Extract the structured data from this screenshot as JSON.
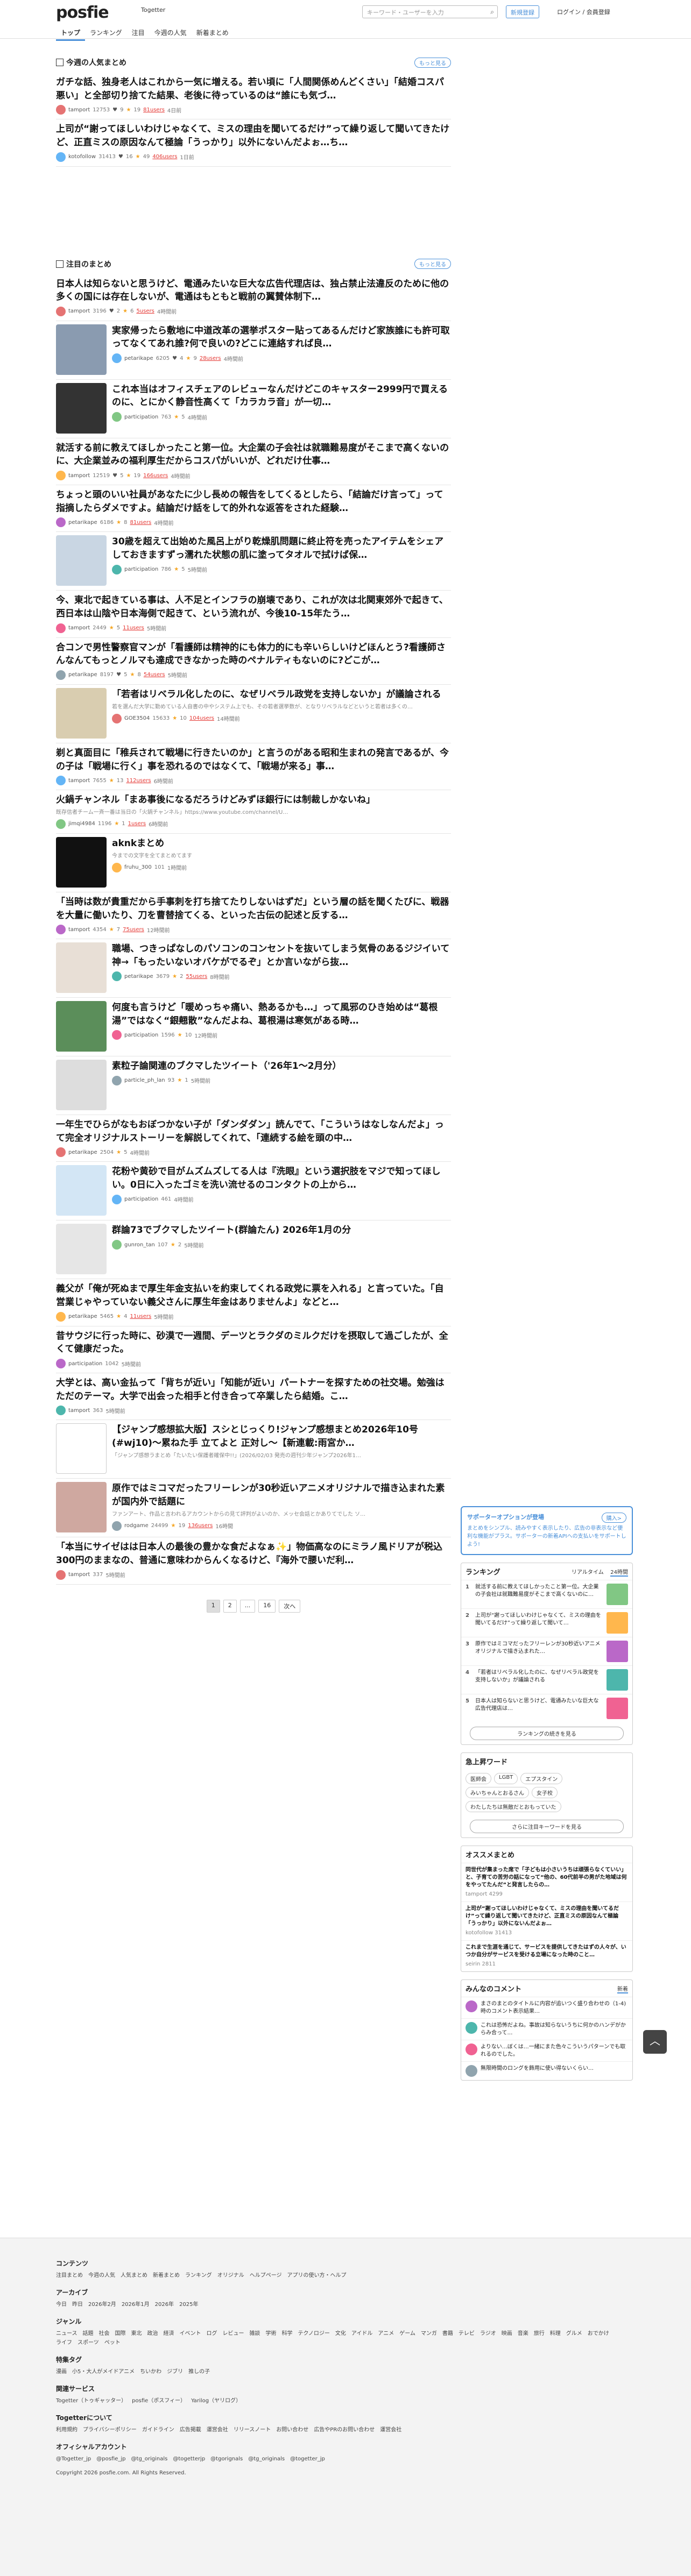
{
  "header": {
    "logo": "posfie",
    "logo_sub": "Togetter",
    "search_placeholder": "キーワード・ユーザーを入力",
    "register": "新規登録",
    "login": "ログイン / 会員登録",
    "nav": [
      "トップ",
      "ランキング",
      "注目",
      "今週の人気",
      "新着まとめ"
    ]
  },
  "popular": {
    "title": "今週の人気まとめ",
    "more": "もっと見る",
    "items": [
      {
        "title": "ガチな話、独身老人はこれから一気に増える。若い頃に「人間関係めんどくさい」「結婚コスパ悪い」と全部切り捨てた結果、老後に待っているのは“誰にも気づ…",
        "user": "tamport",
        "views": "12753",
        "fav": "9",
        "stars": "19",
        "bk": "81users",
        "date": "4日前"
      },
      {
        "title": "上司が“謝ってほしいわけじゃなくて、ミスの理由を聞いてるだけ”って繰り返して聞いてきたけど、正直ミスの原因なんて極論「うっかり」以外にないんだよぉ…ち…",
        "user": "kotofollow",
        "views": "31413",
        "fav": "16",
        "stars": "49",
        "bk": "406users",
        "date": "1日前"
      }
    ]
  },
  "featured": {
    "title": "注目のまとめ",
    "more": "もっと見る",
    "items": [
      {
        "title": "日本人は知らないと思うけど、電通みたいな巨大な広告代理店は、独占禁止法違反のために他の多くの国には存在しないが、電通はもともと戦前の翼賛体制下…",
        "user": "tamport",
        "views": "3196",
        "fav": "2",
        "stars": "6",
        "bk": "5users",
        "date": "4時間前",
        "thumb": ""
      },
      {
        "title": "実家帰ったら敷地に中道改革の選挙ポスター貼ってあるんだけど家族誰にも許可取ってなくてあれ誰?何で良いの?どこに連絡すれば良…",
        "user": "petarikape",
        "views": "6205",
        "fav": "4",
        "stars": "9",
        "bk": "28users",
        "date": "4時間前",
        "thumb": "#8a9bb0"
      },
      {
        "title": "これ本当はオフィスチェアのレビューなんだけどこのキャスター2999円で買えるのに、とにかく静音性高くて「カラカラ音」が一切…",
        "user": "participation",
        "views": "763",
        "fav": "",
        "stars": "5",
        "bk": "",
        "date": "4時間前",
        "thumb": "#333333"
      },
      {
        "title": "就活する前に教えてほしかったこと第一位。大企業の子会社は就職難易度がそこまで高くないのに、大企業並みの福利厚生だからコスパがいいが、どれだけ仕事…",
        "user": "tamport",
        "views": "12519",
        "fav": "5",
        "stars": "19",
        "bk": "166users",
        "date": "4時間前",
        "thumb": ""
      },
      {
        "title": "ちょっと頭のいい社員があなたに少し長めの報告をしてくるとしたら、「結論だけ言って」って指摘したらダメですよ。結論だけ話をして的外れな返答をされた経験…",
        "user": "petarikape",
        "views": "6186",
        "fav": "",
        "stars": "8",
        "bk": "81users",
        "date": "4時間前",
        "thumb": ""
      },
      {
        "title": "30歳を超えて出始めた風呂上がり乾燥肌問題に終止符を売ったアイテムをシェアしておきますずっ濡れた状態の肌に塗ってタオルで拭けば保…",
        "user": "participation",
        "views": "786",
        "fav": "",
        "stars": "5",
        "bk": "",
        "date": "5時間前",
        "thumb": "#c9d6e3"
      },
      {
        "title": "今、東北で起きている事は、人不足とインフラの崩壊であり、これが次は北関東郊外で起きて、西日本は山陰や日本海側で起きて、という流れが、今後10-15年たう…",
        "user": "tamport",
        "views": "2449",
        "fav": "",
        "stars": "5",
        "bk": "11users",
        "date": "5時間前",
        "thumb": ""
      },
      {
        "title": "合コンで男性警察官マンが「看護師は精神的にも体力的にも辛いらしいけどほんとう?看護師さんなんてもっとノルマも達成できなかった時のペナルティもないのに?どこが…",
        "user": "petarikape",
        "views": "8197",
        "fav": "5",
        "stars": "8",
        "bk": "54users",
        "date": "5時間前",
        "thumb": ""
      },
      {
        "title": "「若者はリベラル化したのに、なぜリベラル政党を支持しないか」が議論される",
        "desc": "若を選んだ大学に勤めている人自書の中やシステム上でも、その若者選挙数が、となりリベラルなどというと若者は多くの…",
        "user": "GOE3504",
        "views": "15633",
        "fav": "",
        "stars": "10",
        "bk": "104users",
        "date": "14時間前",
        "thumb": "#d9cdb0"
      },
      {
        "title": "剃と真面目に「稚兵されて戦場に行きたいのか」と言うのがある昭和生まれの発言であるが、今の子は「戦場に行く」事を恐れるのではなくて、「戦場が来る」事…",
        "user": "tamport",
        "views": "7655",
        "fav": "",
        "stars": "13",
        "bk": "112users",
        "date": "6時間前",
        "thumb": ""
      },
      {
        "title": "火鍋チャンネル「まあ事後になるだろうけどみずほ銀行には制裁しかないね」",
        "desc": "既存信者チーム一斉一番は当日の「火鍋チャンネル」https://www.youtube.com/channel/U…",
        "user": "jimqi4984",
        "views": "1196",
        "fav": "",
        "stars": "1",
        "bk": "1users",
        "date": "6時間前",
        "thumb": ""
      },
      {
        "title": "aknkまとめ",
        "desc": "今までの文字を全てまとめてます",
        "user": "fruhu_300",
        "views": "101",
        "fav": "",
        "stars": "",
        "bk": "",
        "date": "1時間前",
        "thumb": "#111111"
      },
      {
        "title": "「当時は数が貴重だから手事刺を打ち捨てたりしないはずだ」という層の話を聞くたびに、戦器を大量に働いたり、刀を曹替捨てくる、といった古伝の記述と反する…",
        "user": "tamport",
        "views": "4354",
        "fav": "",
        "stars": "7",
        "bk": "75users",
        "date": "12時間前",
        "thumb": ""
      },
      {
        "title": "職場、つきっぱなしのパソコンのコンセントを抜いてしまう気骨のあるジジイいて神→「もったいないオバケがでるぞ」とか言いながら抜…",
        "user": "petarikape",
        "views": "3679",
        "fav": "",
        "stars": "2",
        "bk": "55users",
        "date": "8時間前",
        "thumb": "#e8dfd6"
      },
      {
        "title": "何度も言うけど「暖めっちゃ痛い、熱あるかも…」って風邪のひき始めは“葛根湯”ではなく“銀翹散”なんだよね、葛根湯は寒気がある時…",
        "user": "participation",
        "views": "1596",
        "fav": "",
        "stars": "10",
        "bk": "",
        "date": "12時間前",
        "thumb": "#5b8e5a"
      },
      {
        "title": "素粒子論関連のブクマしたツイート（'26年1〜2月分）",
        "user": "particle_ph_lan",
        "views": "93",
        "fav": "",
        "stars": "1",
        "bk": "",
        "date": "5時間前",
        "thumb": "#dddddd"
      },
      {
        "title": "一年生でひらがなもおぼつかない子が「ダンダダン」読んでて、「こういうはなしなんだよ」って完全オリジナルストーリーを解説してくれて、「連続する絵を頭の中…",
        "user": "petarikape",
        "views": "2504",
        "fav": "",
        "stars": "5",
        "bk": "",
        "date": "4時間前",
        "thumb": ""
      },
      {
        "title": "花粉や黄砂で目がムズムズしてる人は『洗眼』という選択肢をマジで知ってほしい。0日に入ったゴミを洗い流せるのコンタクトの上から…",
        "user": "participation",
        "views": "461",
        "fav": "",
        "stars": "",
        "bk": "",
        "date": "4時間前",
        "thumb": "#d3e6f5"
      },
      {
        "title": "群論73でブクマしたツイート(群論たん) 2026年1月の分",
        "user": "gunron_tan",
        "views": "107",
        "fav": "",
        "stars": "2",
        "bk": "",
        "date": "5時間前",
        "thumb": "#e6e6e6"
      },
      {
        "title": "義父が「俺が死ぬまで厚生年金支払いを約束してくれる政党に票を入れる」と言っていた。「自営業じゃやっていない義父さんに厚生年金はありませんよ」などと…",
        "user": "petarikape",
        "views": "5465",
        "fav": "",
        "stars": "4",
        "bk": "11users",
        "date": "5時間前",
        "thumb": ""
      },
      {
        "title": "昔サウジに行った時に、砂漠で一週間、デーツとラクダのミルクだけを摂取して過ごしたが、全くて健康だった。",
        "user": "participation",
        "views": "1042",
        "fav": "",
        "stars": "",
        "bk": "",
        "date": "5時間前",
        "thumb": ""
      },
      {
        "title": "大学とは、高い金払って「背ちが近い」「知能が近い」パートナーを探すための社交場。勉強はただのテーマ。大学で出会った相手と付き合って卒業したら結婚。こ…",
        "user": "tamport",
        "views": "363",
        "fav": "",
        "stars": "",
        "bk": "",
        "date": "5時間前",
        "thumb": ""
      },
      {
        "title": "【ジャンプ感想拡大版】スシとじっくり!ジャンプ感想まとめ2026年10号(#wj10)〜累ねた手 立てよと 正対し〜【新連載:雨宮か…",
        "desc": "「ジャンプ感想ラまとめ「たいたい保護者確保中!!」(2026/02/03 発売の週刊少年ジャンプ2026年1…",
        "user": "",
        "views": "",
        "fav": "",
        "stars": "",
        "bk": "",
        "date": "",
        "thumb": "#ffffff"
      },
      {
        "title": "原作ではミコマだったフリーレンが30秒近いアニメオリジナルで描き込まれた素が国内外で話題に",
        "desc": "ファンアート、作品と言われるアカウントからの見て評判がよいのか、メッセ会話とかありてでした ソ…",
        "user": "rodgame",
        "views": "24499",
        "fav": "",
        "stars": "19",
        "bk": "136users",
        "date": "16時間",
        "thumb": "#cfa8a0"
      },
      {
        "title": "「本当にサイゼはは日本人の最後の豊かな食だよなぁ✨」物価高なのにミラノ風ドリアが税込300円のままなの、普通に意味わからんくなるけど、『海外で腰いだ利…",
        "user": "tamport",
        "views": "337",
        "fav": "",
        "stars": "",
        "bk": "",
        "date": "5時間前",
        "thumb": ""
      }
    ]
  },
  "pager": [
    "1",
    "2",
    "...",
    "16",
    "次へ"
  ],
  "sidebar": {
    "support_title": "サポーターオプションが登場",
    "support_btn": "購入>",
    "support_text": "まとめをシンプル、読みやすく表示したり、広告の非表示など便利な機能がプラス。サポーターの新着APIへの支払いをサポートしよう!",
    "ranking_title": "ランキング",
    "ranking_tabs": [
      "リアルタイム",
      "24時間"
    ],
    "ranking": [
      "就活する前に教えてほしかったこと第一位。大企業の子会社は就職難易度がそこまで高くないのに…",
      "上司が“謝ってほしいわけじゃなくて、ミスの理由を聞いてるだけ”って繰り返して聞いて…",
      "原作ではミコマだったフリーレンが30秒近いアニメオリジナルで描き込まれた…",
      "「若者はリベラル化したのに、なぜリベラル政党を支持しないか」が議論される",
      "日本人は知らないと思うけど、電通みたいな巨大な広告代理店は…"
    ],
    "ranking_more": "ランキングの続きを見る",
    "trend_title": "急上昇ワード",
    "trend_tags": [
      "医師会",
      "LGBT",
      "エプスタイン",
      "みいちゃんとおるさん",
      "女子校",
      "わたしたちは無敵だとおもっていた"
    ],
    "trend_more": "さらに注目キーワードを見る",
    "rec_title": "オススメまとめ",
    "recs": [
      {
        "t": "同世代が集まった席で「子どもは小さいうちは頑張らなくていい」と、子育ての苦労の話になって“他の、60代前半の男がた地域は何をやってたんだ”と発言したらの…",
        "m": "tamport 4299"
      },
      {
        "t": "上司が“謝ってほしいわけじゃなくて、ミスの理由を聞いてるだけ”って繰り返して聞いてきたけど、正直ミスの原因なんて極論「うっかり」以外にないんだよぉ…",
        "m": "kotofollow 31413"
      },
      {
        "t": "これまで生涯を通じて、サービスを提供してきたはずの人々が、いつか自分がサービスを受ける立場になった時のこと…",
        "m": "seirin 2811"
      }
    ],
    "comments_title": "みんなのコメント",
    "comments_tabs": [
      "新着"
    ],
    "comments": [
      "まさのまとのタイトルに内容が追いつく盛り合わせの（1-4)時のコメント表示結果…",
      "これは恐怖だよね。事故は知らないうちに何かのハンデがからみ合って…",
      "よりない…ぼくは…一緒にまた色々こういうパターンでも取れるのでした。",
      "無限時間のロングを飾用に使い得ないくらい…"
    ]
  },
  "footer": {
    "content_h": "コンテンツ",
    "content": [
      "注目まとめ",
      "今週の人気",
      "人気まとめ",
      "新着まとめ",
      "ランキング",
      "オリジナル",
      "ヘルプページ",
      "アプリの使い方・ヘルプ"
    ],
    "archive_h": "アーカイブ",
    "archive": [
      "今日",
      "昨日",
      "2026年2月",
      "2026年1月",
      "2026年",
      "2025年"
    ],
    "genre_h": "ジャンル",
    "genre": [
      "ニュース",
      "話題",
      "社会",
      "国際",
      "東北",
      "政治",
      "経済",
      "イベント",
      "ログ",
      "レビュー",
      "雑談",
      "学術",
      "科学",
      "テクノロジー",
      "文化",
      "アイドル",
      "アニメ",
      "ゲーム",
      "マンガ",
      "書籍",
      "テレビ",
      "ラジオ",
      "映画",
      "音楽",
      "旅行",
      "料理",
      "グルメ",
      "おでかけ",
      "ライフ",
      "スポーツ",
      "ペット"
    ],
    "special_h": "特集タグ",
    "special": [
      "漫画",
      "小5・大人がメイドアニメ",
      "ちいかわ",
      "ジブリ",
      "推しの子"
    ],
    "related_h": "関連サービス",
    "related": [
      "Togetter（トゥギャッター）",
      "posfie（ポスフィー）",
      "Yarilog（ヤリログ）"
    ],
    "about_h": "Togetterについて",
    "about": [
      "利用規約",
      "プライバシーポリシー",
      "ガイドライン",
      "広告掲載",
      "運営会社",
      "リリースノート",
      "お問い合わせ",
      "広告やPRのお問い合わせ",
      "運営会社"
    ],
    "official_h": "オフィシャルアカウント",
    "official": [
      "@Togetter_jp",
      "@posfie_jp",
      "@tg_originals",
      "@togetterjp",
      "@tgorignals",
      "@tg_originals",
      "@togetter_jp"
    ],
    "copyright": "Copyright 2026 posfie.com. All Rights Reserved."
  }
}
